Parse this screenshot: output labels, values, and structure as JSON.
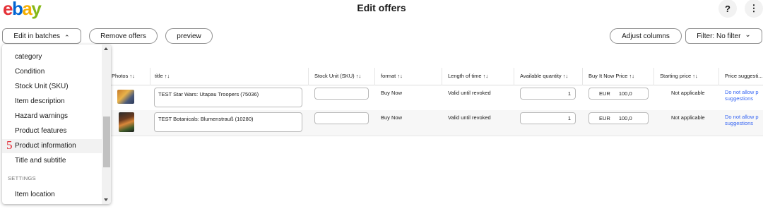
{
  "header": {
    "logo_letters": [
      "e",
      "b",
      "a",
      "y"
    ],
    "title": "Edit offers",
    "help_icon": "?",
    "more_icon": "⋮"
  },
  "toolbar": {
    "edit_in_batches": "Edit in batches",
    "edit_chevron": "⌃",
    "remove_offers": "Remove offers",
    "preview": "preview",
    "adjust_columns": "Adjust columns",
    "filter": "Filter: No filter",
    "filter_chevron": "⌄"
  },
  "dropdown": {
    "items": [
      "category",
      "Condition",
      "Stock Unit (SKU)",
      "Item description",
      "Hazard warnings",
      "Product features",
      "Product information",
      "Title and subtitle"
    ],
    "section": "SETTINGS",
    "section_items": [
      "Item location"
    ],
    "marker": "5"
  },
  "table": {
    "columns": [
      "Photos ↑↓",
      "title ↑↓",
      "Stock Unit (SKU) ↑↓",
      "format ↑↓",
      "Length of time ↑↓",
      "Available quantity ↑↓",
      "Buy It Now Price ↑↓",
      "Starting price ↑↓",
      "Price suggesti..."
    ],
    "rows": [
      {
        "title": "TEST Star Wars: Utapau Troopers (75036)",
        "sku": "",
        "format": "Buy Now",
        "duration": "Valid until revoked",
        "quantity": "1",
        "currency": "EUR",
        "price": "100,0",
        "starting_price": "Not applicable",
        "suggestion_line1": "Do not allow p",
        "suggestion_line2": "suggestions"
      },
      {
        "title": "TEST Botanicals: Blumenstrauß (10280)",
        "sku": "",
        "format": "Buy Now",
        "duration": "Valid until revoked",
        "quantity": "1",
        "currency": "EUR",
        "price": "100,0",
        "starting_price": "Not applicable",
        "suggestion_line1": "Do not allow p",
        "suggestion_line2": "suggestions"
      }
    ]
  },
  "colors": {
    "link": "#3665f3",
    "marker": "#e0202a"
  }
}
